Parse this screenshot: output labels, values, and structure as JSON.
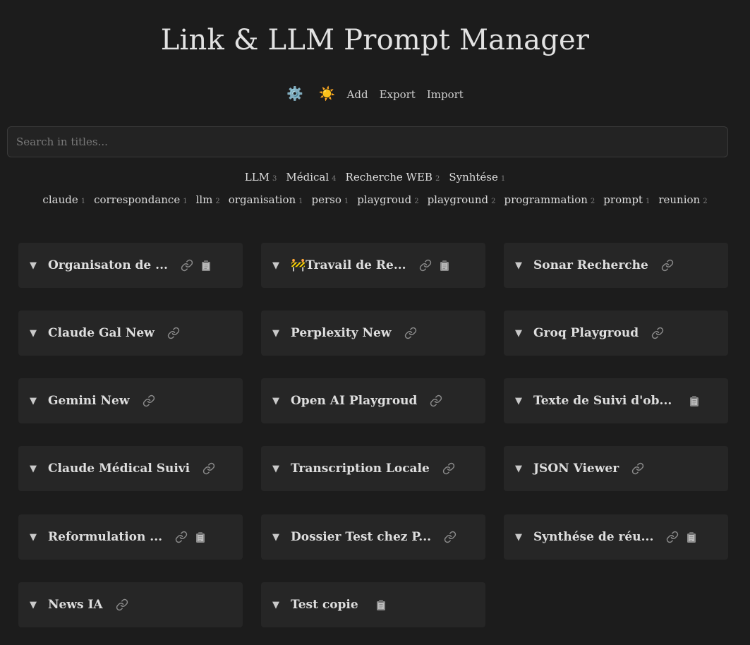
{
  "app": {
    "title": "Link & LLM Prompt Manager"
  },
  "toolbar": {
    "settings_icon": "⚙️",
    "theme_icon": "☀️",
    "add_label": "Add",
    "export_label": "Export",
    "import_label": "Import"
  },
  "search": {
    "placeholder": "Search in titles...",
    "value": ""
  },
  "tags": {
    "primary": [
      {
        "name": "LLM",
        "count": "3"
      },
      {
        "name": "Médical",
        "count": "4"
      },
      {
        "name": "Recherche WEB",
        "count": "2"
      },
      {
        "name": "Synhtése",
        "count": "1"
      }
    ],
    "secondary": [
      {
        "name": "claude",
        "count": "1"
      },
      {
        "name": "correspondance",
        "count": "1"
      },
      {
        "name": "llm",
        "count": "2"
      },
      {
        "name": "organisation",
        "count": "1"
      },
      {
        "name": "perso",
        "count": "1"
      },
      {
        "name": "playgroud",
        "count": "2"
      },
      {
        "name": "playground",
        "count": "2"
      },
      {
        "name": "programmation",
        "count": "2"
      },
      {
        "name": "prompt",
        "count": "1"
      },
      {
        "name": "reunion",
        "count": "2"
      }
    ]
  },
  "cards": [
    {
      "arrow": "▼",
      "title": "Organisaton de ...",
      "link": true,
      "copy": true
    },
    {
      "arrow": "▼",
      "title": "🚧Travail de Re...",
      "link": true,
      "copy": true
    },
    {
      "arrow": "▼",
      "title": "Sonar Recherche",
      "link": true,
      "copy": false
    },
    {
      "arrow": "▼",
      "title": "Claude Gal New",
      "link": true,
      "copy": false
    },
    {
      "arrow": "▼",
      "title": "Perplexity New",
      "link": true,
      "copy": false
    },
    {
      "arrow": "▼",
      "title": "Groq Playgroud",
      "link": true,
      "copy": false
    },
    {
      "arrow": "▼",
      "title": "Gemini New",
      "link": true,
      "copy": false
    },
    {
      "arrow": "▼",
      "title": "Open AI Playgroud",
      "link": true,
      "copy": false
    },
    {
      "arrow": "▼",
      "title": "Texte de Suivi d'ob...",
      "link": false,
      "copy": true
    },
    {
      "arrow": "▼",
      "title": "Claude Médical Suivi",
      "link": true,
      "copy": false
    },
    {
      "arrow": "▼",
      "title": "Transcription Locale",
      "link": true,
      "copy": false
    },
    {
      "arrow": "▼",
      "title": "JSON Viewer",
      "link": true,
      "copy": false
    },
    {
      "arrow": "▼",
      "title": "Reformulation ...",
      "link": true,
      "copy": true
    },
    {
      "arrow": "▼",
      "title": "Dossier Test chez P...",
      "link": true,
      "copy": false
    },
    {
      "arrow": "▼",
      "title": "Synthése de réu...",
      "link": true,
      "copy": true
    },
    {
      "arrow": "▼",
      "title": "News IA",
      "link": true,
      "copy": false
    },
    {
      "arrow": "▼",
      "title": "Test copie",
      "link": false,
      "copy": true
    }
  ]
}
